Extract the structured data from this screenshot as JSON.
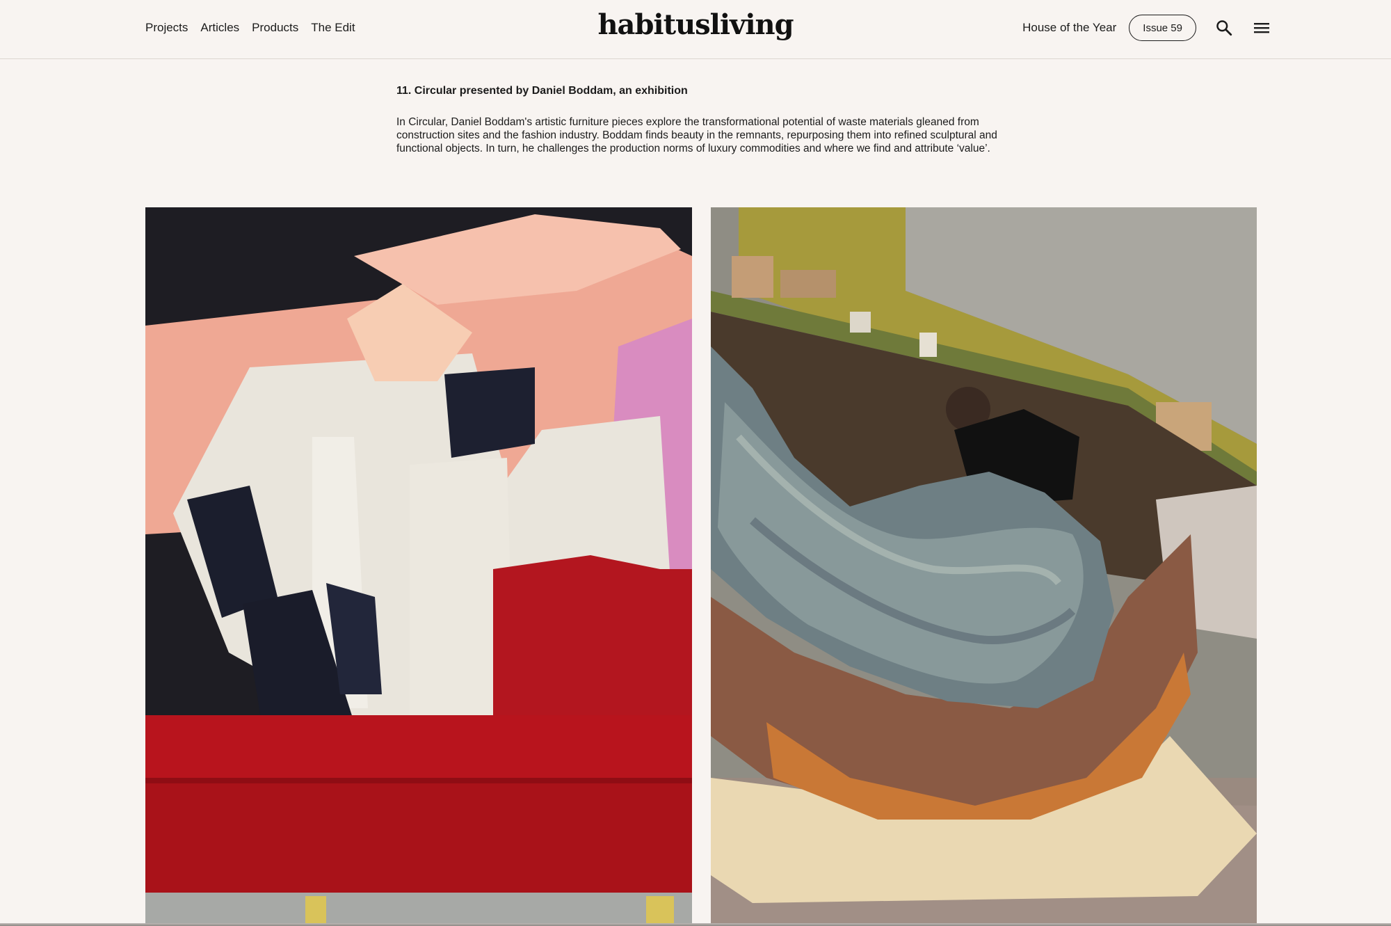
{
  "header": {
    "nav": [
      {
        "label": "Projects"
      },
      {
        "label": "Articles"
      },
      {
        "label": "Products"
      },
      {
        "label": "The Edit"
      }
    ],
    "logo": "habitusliving",
    "house_of_year": "House of the Year",
    "issue_button": "Issue 59",
    "icons": {
      "search": "search-icon",
      "menu": "hamburger-menu-icon"
    }
  },
  "article": {
    "heading": "11. Circular presented by Daniel Boddam, an exhibition",
    "body": "In Circular, Daniel Boddam's artistic furniture pieces explore the transformational potential of waste materials gleaned from construction sites and the fashion industry. Boddam finds beauty in the remnants, repurposing them into refined sculptural and functional objects. In turn, he challenges the production norms of luxury commodities and where we find and attribute ‘value’."
  },
  "colors": {
    "background": "#f8f4f1",
    "text": "#1b1b1b",
    "divider": "#dcd6d1"
  }
}
